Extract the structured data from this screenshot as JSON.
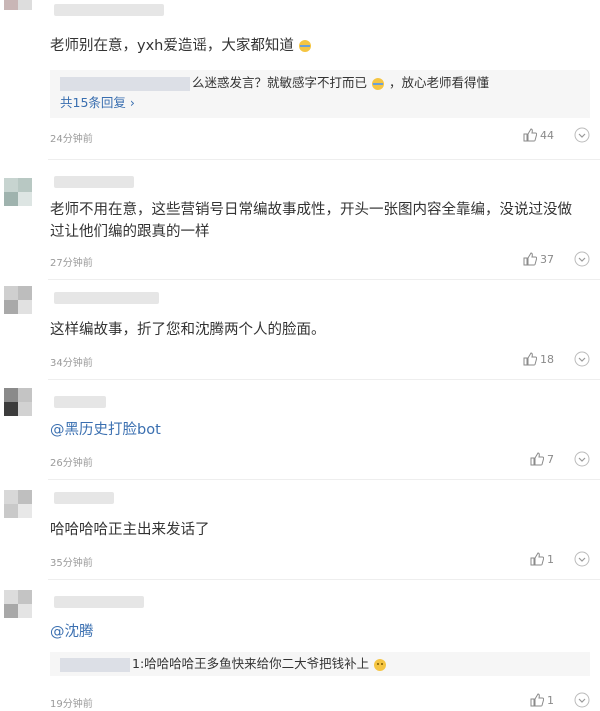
{
  "comments": [
    {
      "text": "老师别在意，yxh爱造谣，大家都知道",
      "reply_text": "么迷惑发言？就敏感字不打而已",
      "reply_text2": "，放心老师看得懂",
      "reply_count": "共15条回复",
      "time": "24分钟前",
      "likes": "44"
    },
    {
      "text": "老师不用在意，这些营销号日常编故事成性，开头一张图内容全靠编，没说过没做过让他们编的跟真的一样",
      "time": "27分钟前",
      "likes": "37"
    },
    {
      "text": "这样编故事，折了您和沈腾两个人的脸面。",
      "time": "34分钟前",
      "likes": "18"
    },
    {
      "text": "@黑历史打脸bot",
      "time": "26分钟前",
      "likes": "7"
    },
    {
      "text": "哈哈哈哈正主出来发话了",
      "time": "35分钟前",
      "likes": "1"
    },
    {
      "text": "@沈腾",
      "reply_text": "1:哈哈哈哈王多鱼快来给你二大爷把钱补上",
      "time": "19分钟前",
      "likes": "1"
    }
  ],
  "colors": {
    "link": "#3a6fb0",
    "meta": "#9a9a9a",
    "reply_bg": "#f6f6f6"
  },
  "icons": {
    "like": "thumb-up-icon",
    "more": "chevron-down-circle-icon",
    "emoji": "smiley-emoji"
  }
}
